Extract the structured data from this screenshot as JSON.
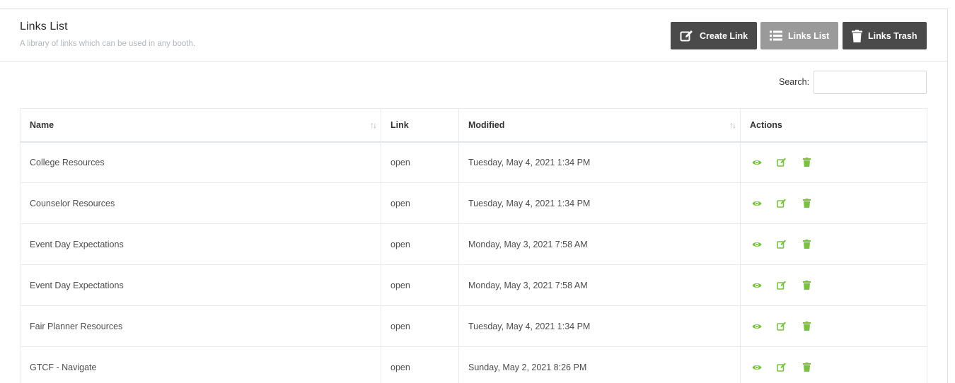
{
  "header": {
    "title": "Links List",
    "subtitle": "A library of links which can be used in any booth."
  },
  "toolbar": {
    "create_label": "Create Link",
    "list_label": "Links List",
    "trash_label": "Links Trash"
  },
  "search": {
    "label": "Search:",
    "value": ""
  },
  "table": {
    "columns": [
      "Name",
      "Link",
      "Modified",
      "Actions"
    ],
    "rows": [
      {
        "name": "College Resources",
        "link": "open",
        "modified": "Tuesday, May 4, 2021 1:34 PM"
      },
      {
        "name": "Counselor Resources",
        "link": "open",
        "modified": "Tuesday, May 4, 2021 1:34 PM"
      },
      {
        "name": "Event Day Expectations",
        "link": "open",
        "modified": "Monday, May 3, 2021 7:58 AM"
      },
      {
        "name": "Event Day Expectations",
        "link": "open",
        "modified": "Monday, May 3, 2021 7:58 AM"
      },
      {
        "name": "Fair Planner Resources",
        "link": "open",
        "modified": "Tuesday, May 4, 2021 1:34 PM"
      },
      {
        "name": "GTCF - Navigate",
        "link": "open",
        "modified": "Sunday, May 2, 2021 8:26 PM"
      }
    ]
  },
  "colors": {
    "action_green": "#7ac142",
    "button_dark": "#4a4a4a",
    "button_active": "#9a9a9a"
  },
  "icons": {
    "create": "edit-icon",
    "list": "list-icon",
    "trash": "trash-icon",
    "view": "eye-icon",
    "edit": "edit-icon",
    "delete": "trash-icon",
    "sort": "sort-icon"
  }
}
